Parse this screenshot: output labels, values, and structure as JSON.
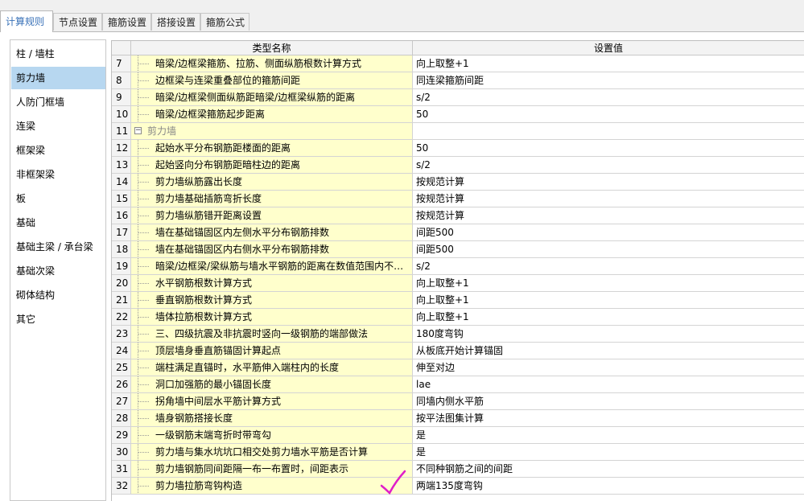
{
  "tabs": [
    {
      "label": "计算规则",
      "active": true
    },
    {
      "label": "节点设置",
      "active": false
    },
    {
      "label": "箍筋设置",
      "active": false
    },
    {
      "label": "搭接设置",
      "active": false
    },
    {
      "label": "箍筋公式",
      "active": false
    }
  ],
  "sidebar": {
    "selected": "剪力墙",
    "items": [
      "柱 / 墙柱",
      "剪力墙",
      "人防门框墙",
      "连梁",
      "框架梁",
      "非框架梁",
      "板",
      "基础",
      "基础主梁 / 承台梁",
      "基础次梁",
      "砌体结构",
      "其它"
    ]
  },
  "table": {
    "headers": {
      "name": "类型名称",
      "value": "设置值"
    },
    "rows": [
      {
        "num": "7",
        "name": "暗梁/边框梁箍筋、拉筋、侧面纵筋根数计算方式",
        "value": "向上取整+1"
      },
      {
        "num": "8",
        "name": "边框梁与连梁重叠部位的箍筋间距",
        "value": "同连梁箍筋间距"
      },
      {
        "num": "9",
        "name": "暗梁/边框梁侧面纵筋距暗梁/边框梁纵筋的距离",
        "value": "s/2"
      },
      {
        "num": "10",
        "name": "暗梁/边框梁箍筋起步距离",
        "value": "50"
      },
      {
        "num": "11",
        "name": "剪力墙",
        "value": "",
        "group": true,
        "expander": "−"
      },
      {
        "num": "12",
        "name": "起始水平分布钢筋距楼面的距离",
        "value": "50"
      },
      {
        "num": "13",
        "name": "起始竖向分布钢筋距暗柱边的距离",
        "value": "s/2"
      },
      {
        "num": "14",
        "name": "剪力墙纵筋露出长度",
        "value": "按规范计算"
      },
      {
        "num": "15",
        "name": "剪力墙基础插筋弯折长度",
        "value": "按规范计算"
      },
      {
        "num": "16",
        "name": "剪力墙纵筋错开距离设置",
        "value": "按规范计算"
      },
      {
        "num": "17",
        "name": "墙在基础锚固区内左侧水平分布钢筋排数",
        "value": "间距500"
      },
      {
        "num": "18",
        "name": "墙在基础锚固区内右侧水平分布钢筋排数",
        "value": "间距500"
      },
      {
        "num": "19",
        "name": "暗梁/边框梁/梁纵筋与墙水平钢筋的距离在数值范围内不…",
        "value": "s/2"
      },
      {
        "num": "20",
        "name": "水平钢筋根数计算方式",
        "value": "向上取整+1"
      },
      {
        "num": "21",
        "name": "垂直钢筋根数计算方式",
        "value": "向上取整+1"
      },
      {
        "num": "22",
        "name": "墙体拉筋根数计算方式",
        "value": "向上取整+1"
      },
      {
        "num": "23",
        "name": "三、四级抗震及非抗震时竖向一级钢筋的端部做法",
        "value": "180度弯钩"
      },
      {
        "num": "24",
        "name": "顶层墙身垂直筋锚固计算起点",
        "value": "从板底开始计算锚固"
      },
      {
        "num": "25",
        "name": "端柱满足直锚时，水平筋伸入端柱内的长度",
        "value": "伸至对边"
      },
      {
        "num": "26",
        "name": "洞口加强筋的最小锚固长度",
        "value": "lae"
      },
      {
        "num": "27",
        "name": "拐角墙中间层水平筋计算方式",
        "value": "同墙内侧水平筋"
      },
      {
        "num": "28",
        "name": "墙身钢筋搭接长度",
        "value": "按平法图集计算"
      },
      {
        "num": "29",
        "name": "一级钢筋末端弯折时带弯勾",
        "value": "是"
      },
      {
        "num": "30",
        "name": "剪力墙与集水坑坑口相交处剪力墙水平筋是否计算",
        "value": "是"
      },
      {
        "num": "31",
        "name": "剪力墙钢筋同间距隔一布一布置时，间距表示",
        "value": "不同种钢筋之间的间距"
      },
      {
        "num": "32",
        "name": "剪力墙拉筋弯钩构造",
        "value": "两端135度弯钩"
      }
    ]
  },
  "annotation": {
    "color": "#e01ec8",
    "icon": "checkmark-icon"
  }
}
